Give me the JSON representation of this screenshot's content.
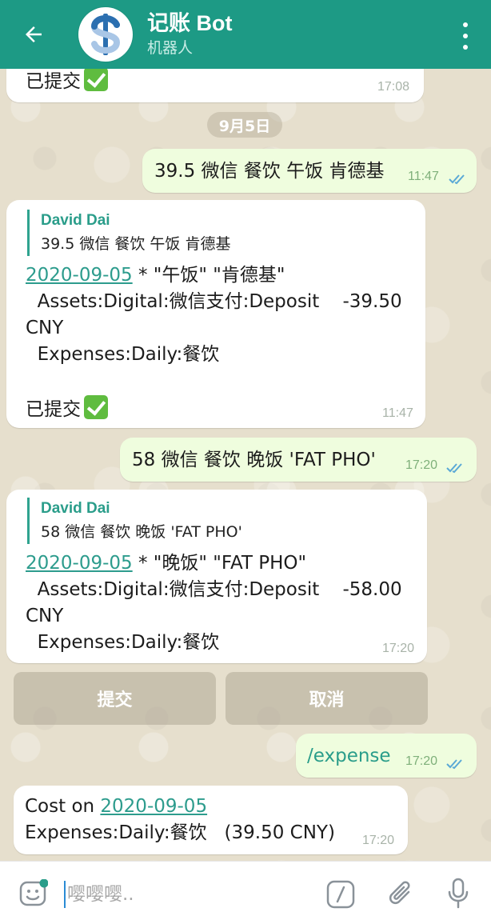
{
  "header": {
    "title": "记账 Bot",
    "subtitle": "机器人",
    "avatar_icon": "dollar-icon",
    "color": "#1d9a85"
  },
  "date_divider": "9月5日",
  "messages": [
    {
      "id": "m0",
      "direction": "in",
      "text": "已提交",
      "time": "17:08"
    },
    {
      "id": "m1",
      "direction": "out",
      "text": "39.5 微信 餐饮 午饭 肯德基",
      "time": "11:47"
    },
    {
      "id": "m2",
      "direction": "in",
      "quote_name": "David Dai",
      "quote_text": "39.5 微信 餐饮 午饭 肯德基",
      "date_link": "2020-09-05",
      "line1_rest": " * \"午饭\" \"肯德基\"",
      "line2": "  Assets:Digital:微信支付:Deposit    -39.50",
      "line3": "CNY",
      "line4": "  Expenses:Daily:餐饮",
      "status": "已提交",
      "time": "11:47"
    },
    {
      "id": "m3",
      "direction": "out",
      "text": "58 微信 餐饮 晚饭 'FAT PHO'",
      "time": "17:20"
    },
    {
      "id": "m4",
      "direction": "in",
      "quote_name": "David Dai",
      "quote_text": "58 微信 餐饮 晚饭 'FAT PHO'",
      "date_link": "2020-09-05",
      "line1_rest": " * \"晚饭\" \"FAT PHO\"",
      "line2": "  Assets:Digital:微信支付:Deposit    -58.00",
      "line3": "CNY",
      "line4": "  Expenses:Daily:餐饮",
      "time": "17:20"
    },
    {
      "id": "m5",
      "direction": "out",
      "text": "/expense",
      "time": "17:20"
    },
    {
      "id": "m6",
      "direction": "in",
      "line1_prefix": "Cost on ",
      "date_link": "2020-09-05",
      "line2": "Expenses:Daily:餐饮   (39.50 CNY)",
      "time": "17:20"
    }
  ],
  "keyboard": {
    "submit": "提交",
    "cancel": "取消"
  },
  "input": {
    "placeholder": "嘤嘤嘤.."
  }
}
